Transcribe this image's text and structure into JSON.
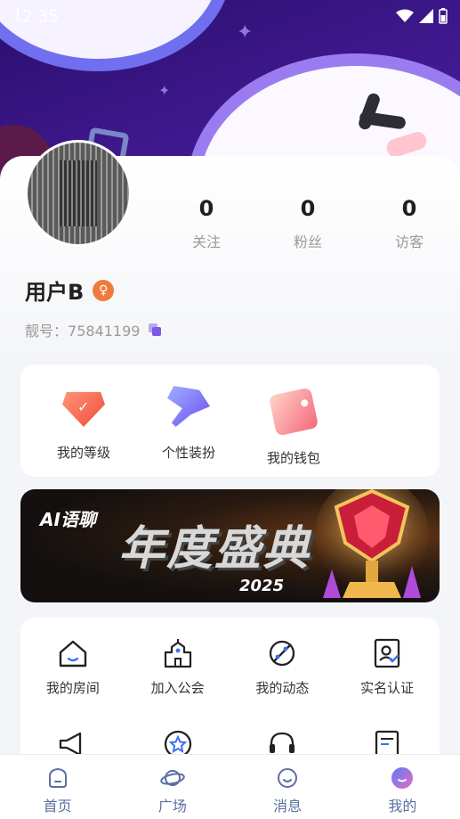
{
  "status_bar": {
    "time": "12:35"
  },
  "profile": {
    "username": "用户B",
    "id_label": "靓号：",
    "id_value": "75841199",
    "stats": [
      {
        "value": "0",
        "label": "关注"
      },
      {
        "value": "0",
        "label": "粉丝"
      },
      {
        "value": "0",
        "label": "访客"
      }
    ]
  },
  "quick_actions": [
    {
      "label": "我的等级",
      "icon": "level-gem-icon"
    },
    {
      "label": "个性装扮",
      "icon": "dress-up-icon"
    },
    {
      "label": "我的钱包",
      "icon": "wallet-icon"
    }
  ],
  "banner": {
    "ai_text": "AI语聊",
    "title": "年度盛典",
    "year": "2025"
  },
  "menu": [
    {
      "label": "我的房间",
      "icon": "house-icon"
    },
    {
      "label": "加入公会",
      "icon": "guild-building-icon"
    },
    {
      "label": "我的动态",
      "icon": "planet-icon"
    },
    {
      "label": "实名认证",
      "icon": "id-verify-icon"
    }
  ],
  "bottom_nav": [
    {
      "label": "首页",
      "icon": "home-icon"
    },
    {
      "label": "广场",
      "icon": "saturn-icon"
    },
    {
      "label": "消息",
      "icon": "chat-icon"
    },
    {
      "label": "我的",
      "icon": "profile-icon",
      "active": true
    }
  ]
}
